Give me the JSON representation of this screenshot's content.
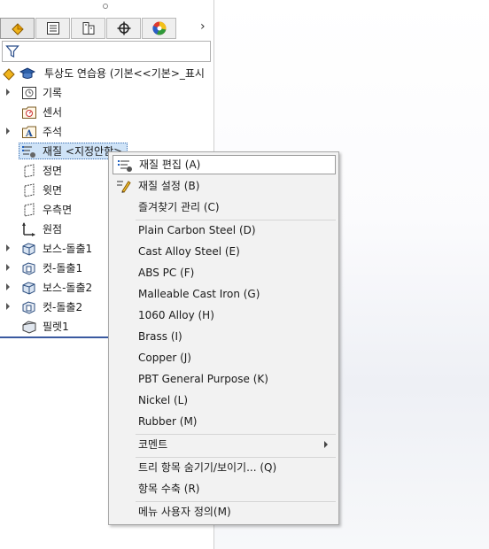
{
  "tabs": [
    "FeatureManager",
    "PropertyManager",
    "ConfigurationManager",
    "DimXpertManager",
    "DisplayManager"
  ],
  "tree": {
    "root_label": "투상도 연습용  (기본<<기본>_표시",
    "items": [
      {
        "label": "기록",
        "icon": "history-icon",
        "expandable": true
      },
      {
        "label": "센서",
        "icon": "sensor-icon",
        "expandable": false
      },
      {
        "label": "주석",
        "icon": "annotation-icon",
        "expandable": true
      },
      {
        "label": "재질 <지정안함>",
        "icon": "material-icon",
        "expandable": false
      },
      {
        "label": "정면",
        "icon": "plane-icon",
        "expandable": false
      },
      {
        "label": "윗면",
        "icon": "plane-icon",
        "expandable": false
      },
      {
        "label": "우측면",
        "icon": "plane-icon",
        "expandable": false
      },
      {
        "label": "원점",
        "icon": "origin-icon",
        "expandable": false
      },
      {
        "label": "보스-돌출1",
        "icon": "boss-extrude-icon",
        "expandable": true
      },
      {
        "label": "컷-돌출1",
        "icon": "cut-extrude-icon",
        "expandable": true
      },
      {
        "label": "보스-돌출2",
        "icon": "boss-extrude-icon",
        "expandable": true
      },
      {
        "label": "컷-돌출2",
        "icon": "cut-extrude-icon",
        "expandable": true
      },
      {
        "label": "필렛1",
        "icon": "fillet-icon",
        "expandable": false
      }
    ]
  },
  "context_menu": {
    "items": [
      {
        "label": "재질 편집 (A)",
        "icon": "edit-material-icon",
        "highlighted": true
      },
      {
        "label": "재질 설정 (B)",
        "icon": "configure-material-icon"
      },
      {
        "label": "즐겨찾기 관리 (C)"
      },
      {
        "label": "Plain Carbon Steel (D)"
      },
      {
        "label": "Cast Alloy Steel (E)"
      },
      {
        "label": "ABS PC (F)"
      },
      {
        "label": "Malleable Cast Iron (G)"
      },
      {
        "label": "1060 Alloy (H)"
      },
      {
        "label": "Brass (I)"
      },
      {
        "label": "Copper (J)"
      },
      {
        "label": "PBT General Purpose (K)"
      },
      {
        "label": "Nickel (L)"
      },
      {
        "label": "Rubber (M)"
      },
      {
        "label": "코멘트",
        "submenu": true
      },
      {
        "label": "트리 항목 숨기기/보이기... (Q)"
      },
      {
        "label": "항목 수축 (R)"
      },
      {
        "label": "메뉴 사용자 정의(M)"
      }
    ]
  },
  "colors": {
    "selection": "#cfe3f7",
    "accent": "#3a5aa0",
    "menu_bg": "#f2f2f2"
  }
}
